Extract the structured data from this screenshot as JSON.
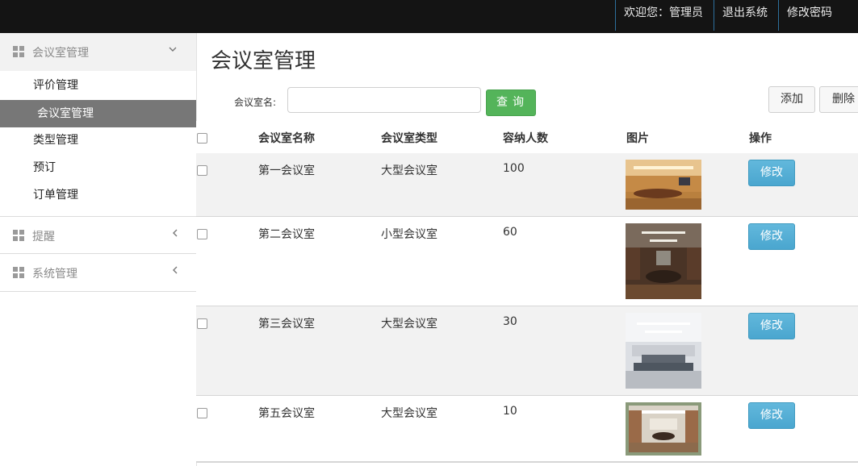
{
  "topbar": {
    "welcome": "欢迎您：管理员",
    "logout": "退出系统",
    "change_password": "修改密码"
  },
  "sidebar": {
    "groups": [
      {
        "label": "会议室管理",
        "icon": "grid-icon",
        "arrow": "chevron-down-icon",
        "expanded": true
      },
      {
        "label": "提醒",
        "icon": "grid-icon",
        "arrow": "chevron-left-icon",
        "expanded": false
      },
      {
        "label": "系统管理",
        "icon": "grid-icon",
        "arrow": "chevron-left-icon",
        "expanded": false
      }
    ],
    "items": [
      {
        "label": "评价管理",
        "active": false
      },
      {
        "label": "会议室管理",
        "active": true
      },
      {
        "label": "类型管理",
        "active": false
      },
      {
        "label": "预订",
        "active": false
      },
      {
        "label": "订单管理",
        "active": false
      }
    ]
  },
  "main": {
    "title": "会议室管理",
    "search": {
      "label": "会议室名:",
      "value": "",
      "button": "查询"
    },
    "actions": {
      "add": "添加",
      "delete": "删除"
    }
  },
  "table": {
    "headers": [
      "会议室名称",
      "会议室类型",
      "容纳人数",
      "图片",
      "操作"
    ],
    "rows": [
      {
        "name": "第一会议室",
        "type": "大型会议室",
        "capacity": "100",
        "action": "修改"
      },
      {
        "name": "第二会议室",
        "type": "小型会议室",
        "capacity": "60",
        "action": "修改"
      },
      {
        "name": "第三会议室",
        "type": "大型会议室",
        "capacity": "30",
        "action": "修改"
      },
      {
        "name": "第五会议室",
        "type": "大型会议室",
        "capacity": "10",
        "action": "修改"
      }
    ]
  },
  "colors": {
    "topbar": "#141414",
    "active_item": "#777777",
    "query_button": "#54b45a",
    "edit_button": "#4aa6cf"
  }
}
